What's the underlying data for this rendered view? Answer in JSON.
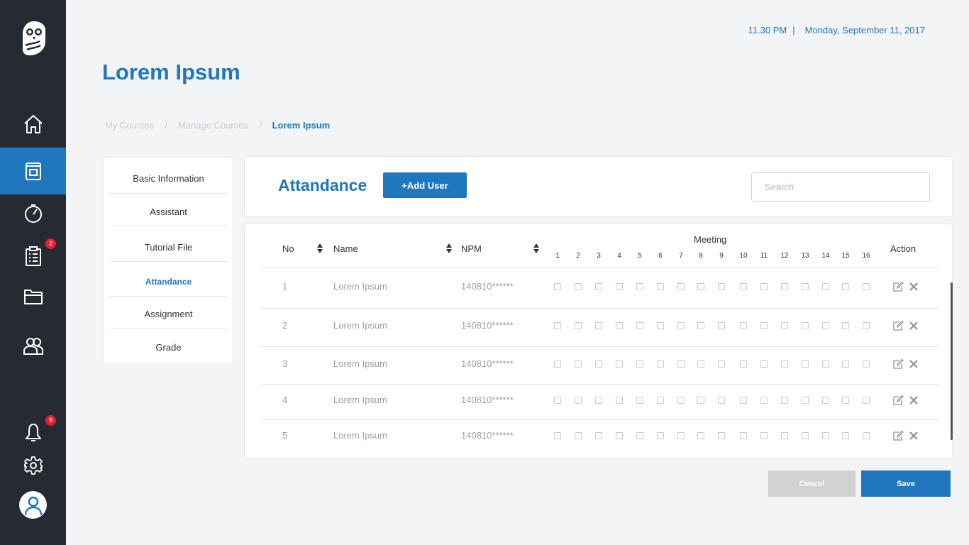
{
  "header": {
    "time": "11.30 PM",
    "separator": "|",
    "date": "Monday, September 11, 2017",
    "page_title": "Lorem Ipsum"
  },
  "breadcrumb": {
    "items": [
      "My Courses",
      "Manage Courses"
    ],
    "separator": "/",
    "current": "Lorem Ipsum"
  },
  "sidebar": {
    "nav": [
      {
        "icon": "home-icon",
        "active": false
      },
      {
        "icon": "book-icon",
        "active": true
      },
      {
        "icon": "timer-icon",
        "active": false
      },
      {
        "icon": "clipboard-icon",
        "active": false,
        "badge": "2"
      },
      {
        "icon": "folder-icon",
        "active": false
      },
      {
        "icon": "users-icon",
        "active": false
      }
    ],
    "notifications_badge": "8",
    "colors": {
      "background": "#262b33",
      "active": "#1f78bd",
      "badge": "#e0212b"
    }
  },
  "menu": {
    "items": [
      "Basic Information",
      "Assistant",
      "Tutorial File",
      "Attandance",
      "Assignment",
      "Grade"
    ],
    "active": "Attandance"
  },
  "attendance": {
    "title": "Attandance",
    "add_user_label": "+Add User",
    "search_placeholder": "Search"
  },
  "table": {
    "headers": {
      "no": "No",
      "name": "Name",
      "npm": "NPM",
      "meeting": "Meeting",
      "action": "Action"
    },
    "meetings": [
      "1",
      "2",
      "3",
      "4",
      "5",
      "6",
      "7",
      "8",
      "9",
      "10",
      "11",
      "12",
      "13",
      "14",
      "15",
      "16"
    ],
    "rows": [
      {
        "no": "1",
        "name": "Lorem Ipsum",
        "npm": "140810******"
      },
      {
        "no": "2",
        "name": "Lorem Ipsum",
        "npm": "140810******"
      },
      {
        "no": "3",
        "name": "Lorem Ipsum",
        "npm": "140810******"
      },
      {
        "no": "4",
        "name": "Lorem Ipsum",
        "npm": "140810******"
      },
      {
        "no": "5",
        "name": "Lorem Ipsum",
        "npm": "140810******"
      }
    ]
  },
  "footer": {
    "cancel_label": "Cencel",
    "save_label": "Save"
  },
  "colors": {
    "primary": "#1f78bd",
    "page_bg": "#f3f4f6",
    "cancel": "#d1d2d3"
  }
}
